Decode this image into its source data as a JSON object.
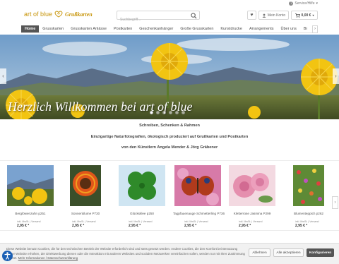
{
  "service": {
    "label": "Service/Hilfe"
  },
  "logo": {
    "text": "art of blue",
    "sub": "Grußkarten"
  },
  "search": {
    "placeholder": "Suchbegriff..."
  },
  "header": {
    "account_label": "Mein Konto",
    "cart_total": "0,00 €"
  },
  "nav": {
    "items": [
      "Home",
      "Grusskarten",
      "Grusskarten Anlässe",
      "Postkarten",
      "Geschenkanhänger",
      "Große Grusskarten",
      "Kunstdrucke",
      "Arrangements",
      "Über uns",
      "Bi"
    ]
  },
  "hero": {
    "title": "Herzlich Willkommen bei art of blue",
    "slides": 6,
    "active_slide": 0
  },
  "intro": {
    "line1": "Schreiben, Schenken & Rahmen",
    "line2": "Einzigartige Naturfotografien, ökologisch produziert auf Grußkarten und Postkarten",
    "line3": "von den Künstlern Angela Mender & Jörg Gräbener"
  },
  "products": [
    {
      "name": "Berglöwenzahn p251",
      "tax": "inkl. MwSt. | Versand",
      "price": "2,95 € *"
    },
    {
      "name": "Sonnenblume P730",
      "tax": "inkl. MwSt. | Versand",
      "price": "2,95 € *"
    },
    {
      "name": "Glücksklee p250",
      "tax": "inkl. MwSt. | Versand",
      "price": "2,95 € *"
    },
    {
      "name": "Tagpfauenauge Schmetterling P736",
      "tax": "inkl. MwSt. | Versand",
      "price": "2,95 € *"
    },
    {
      "name": "Kletterrose Jasmina P299",
      "tax": "inkl. MwSt. | Versand",
      "price": "2,95 € *"
    },
    {
      "name": "Blumenteppich p262",
      "tax": "inkl. MwSt. | Versand",
      "price": "2,95 € *"
    }
  ],
  "cookie": {
    "text": "Diese Website benutzt Cookies, die für den technischen Betrieb der Website erforderlich sind und stets gesetzt werden. Andere Cookies, die den Komfort bei Benutzung dieser Website erhöhen, der Direktwerbung dienen oder die Interaktion mit anderen Websites und sozialen Netzwerken vereinfachen sollen, werden nur mit Ihrer Zustimmung gesetzt.",
    "link": "Mehr Informationen / Datenschutzerklärung",
    "decline": "Ablehnen",
    "accept": "Alle akzeptieren",
    "configure": "Konfigurieren"
  },
  "colors": {
    "brand": "#c8960c",
    "nav_active": "#555555"
  }
}
